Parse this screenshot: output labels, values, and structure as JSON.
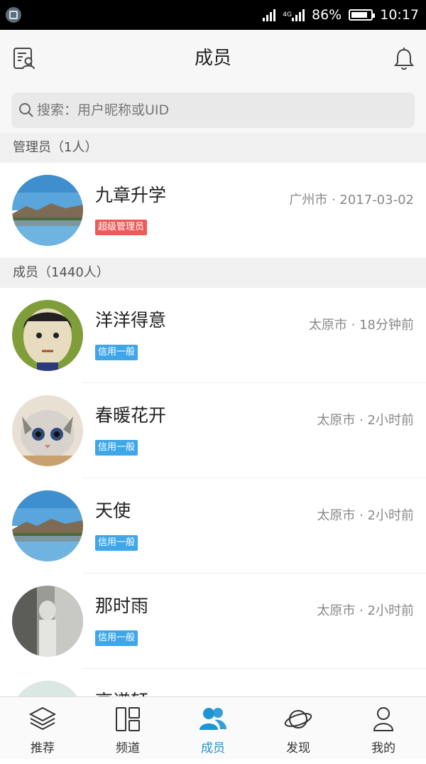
{
  "status_bar": {
    "network": "4G",
    "battery_percent": "86%",
    "battery_level": 0.86,
    "time": "10:17"
  },
  "header": {
    "title": "成员",
    "left_icon": "member-card-icon",
    "right_icon": "bell-icon"
  },
  "search": {
    "placeholder": "搜索：用户昵称或UID",
    "value": ""
  },
  "sections": [
    {
      "title": "管理员（1人）",
      "members": [
        {
          "name": "九章升学",
          "meta": "广州市 · 2017-03-02",
          "badge": "超级管理员",
          "badge_color": "#ec5a5a",
          "avatar": "lake-landscape"
        }
      ]
    },
    {
      "title": "成员（1440人）",
      "members": [
        {
          "name": "洋洋得意",
          "meta": "太原市 · 18分钟前",
          "badge": "信用一般",
          "badge_color": "#3ea7ea",
          "avatar": "cartoon-boy"
        },
        {
          "name": "春暖花开",
          "meta": "太原市 · 2小时前",
          "badge": "信用一般",
          "badge_color": "#3ea7ea",
          "avatar": "kitten"
        },
        {
          "name": "天使",
          "meta": "太原市 · 2小时前",
          "badge": "信用一般",
          "badge_color": "#3ea7ea",
          "avatar": "lake-landscape"
        },
        {
          "name": "那时雨",
          "meta": "太原市 · 2小时前",
          "badge": "信用一般",
          "badge_color": "#3ea7ea",
          "avatar": "grey-figure"
        },
        {
          "name": "高谱轩",
          "meta": "",
          "badge": "",
          "avatar": "partial"
        }
      ]
    }
  ],
  "tabbar": {
    "active_color": "#1e94d4",
    "items": [
      {
        "label": "推荐",
        "icon": "layers-icon"
      },
      {
        "label": "频道",
        "icon": "grid-icon"
      },
      {
        "label": "成员",
        "icon": "members-icon",
        "active": true
      },
      {
        "label": "发现",
        "icon": "planet-icon"
      },
      {
        "label": "我的",
        "icon": "user-icon"
      }
    ]
  }
}
